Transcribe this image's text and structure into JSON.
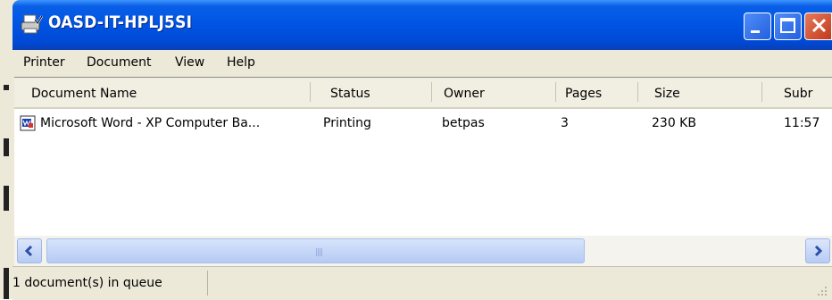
{
  "window": {
    "title": "OASD-IT-HPLJ5SI"
  },
  "menu": [
    "Printer",
    "Document",
    "View",
    "Help"
  ],
  "columns": [
    "Document Name",
    "Status",
    "Owner",
    "Pages",
    "Size",
    "Subr"
  ],
  "rows": [
    {
      "name": "Microsoft Word - XP Computer Ba...",
      "status": "Printing",
      "owner": "betpas",
      "pages": "3",
      "size": "230 KB",
      "submitted": "11:57"
    }
  ],
  "scrollbar": {
    "grip": "||||"
  },
  "status_bar": {
    "text": "1 document(s) in queue"
  },
  "icons": {
    "title": "printer-icon",
    "document": "word-document-icon"
  }
}
